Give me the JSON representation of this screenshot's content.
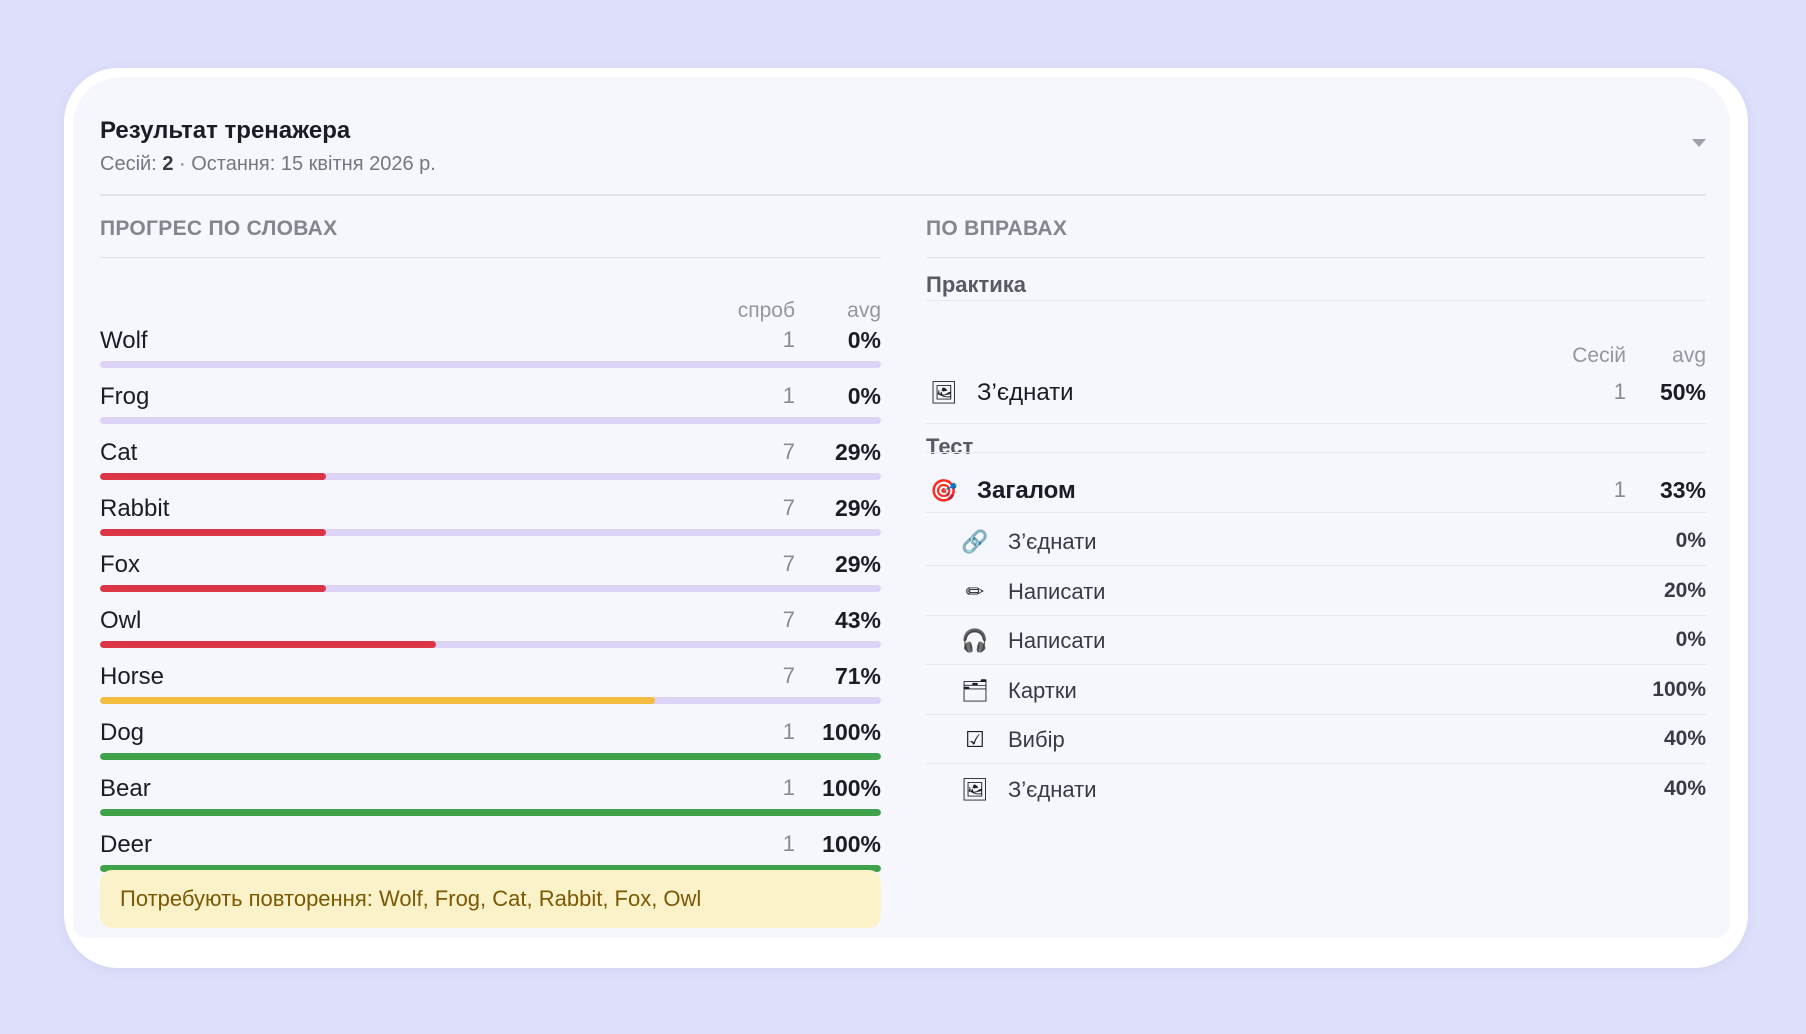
{
  "header": {
    "title": "Результат тренажера",
    "sessions_label": "Сесій:",
    "sessions_count": "2",
    "last_text": "· Остання: 15 квітня 2026 р."
  },
  "words_section": {
    "title": "ПРОГРЕС ПО СЛОВАХ",
    "col_tries": "спроб",
    "col_avg": "avg",
    "rows": [
      {
        "word": "Wolf",
        "tries": "1",
        "avg": "0%",
        "progress": 0,
        "color": "#dc3545"
      },
      {
        "word": "Frog",
        "tries": "1",
        "avg": "0%",
        "progress": 0,
        "color": "#dc3545"
      },
      {
        "word": "Cat",
        "tries": "7",
        "avg": "29%",
        "progress": 0.29,
        "color": "#dc3545"
      },
      {
        "word": "Rabbit",
        "tries": "7",
        "avg": "29%",
        "progress": 0.29,
        "color": "#dc3545"
      },
      {
        "word": "Fox",
        "tries": "7",
        "avg": "29%",
        "progress": 0.29,
        "color": "#dc3545"
      },
      {
        "word": "Owl",
        "tries": "7",
        "avg": "43%",
        "progress": 0.43,
        "color": "#dc3545"
      },
      {
        "word": "Horse",
        "tries": "7",
        "avg": "71%",
        "progress": 0.71,
        "color": "#f5bd3f"
      },
      {
        "word": "Dog",
        "tries": "1",
        "avg": "100%",
        "progress": 1,
        "color": "#3fa24b"
      },
      {
        "word": "Bear",
        "tries": "1",
        "avg": "100%",
        "progress": 1,
        "color": "#3fa24b"
      },
      {
        "word": "Deer",
        "tries": "1",
        "avg": "100%",
        "progress": 1,
        "color": "#3fa24b"
      }
    ],
    "notice": "Потребують повторення: Wolf, Frog, Cat, Rabbit, Fox, Owl"
  },
  "exercises_section": {
    "title": "ПО ВПРАВАХ",
    "practice": {
      "title": "Практика",
      "col_sessions": "Сесій",
      "col_avg": "avg",
      "rows": [
        {
          "icon": "picture-icon",
          "glyph": "🖼",
          "label": "З’єднати",
          "count": "1",
          "avg": "50%"
        }
      ]
    },
    "test": {
      "title": "Тест",
      "total": {
        "icon": "target-icon",
        "glyph": "🎯",
        "label": "Загалом",
        "count": "1",
        "avg": "33%"
      },
      "rows": [
        {
          "icon": "link-icon",
          "glyph": "🔗",
          "label": "З’єднати",
          "avg": "0%"
        },
        {
          "icon": "pencil-icon",
          "glyph": "✏",
          "label": "Написати",
          "avg": "20%"
        },
        {
          "icon": "headphones-icon",
          "glyph": "🎧",
          "label": "Написати",
          "avg": "0%"
        },
        {
          "icon": "cards-icon",
          "glyph": "🗂",
          "label": "Картки",
          "avg": "100%"
        },
        {
          "icon": "checkbox-icon",
          "glyph": "☑",
          "label": "Вибір",
          "avg": "40%"
        },
        {
          "icon": "picture-icon",
          "glyph": "🖼",
          "label": "З’єднати",
          "avg": "40%"
        }
      ]
    }
  }
}
